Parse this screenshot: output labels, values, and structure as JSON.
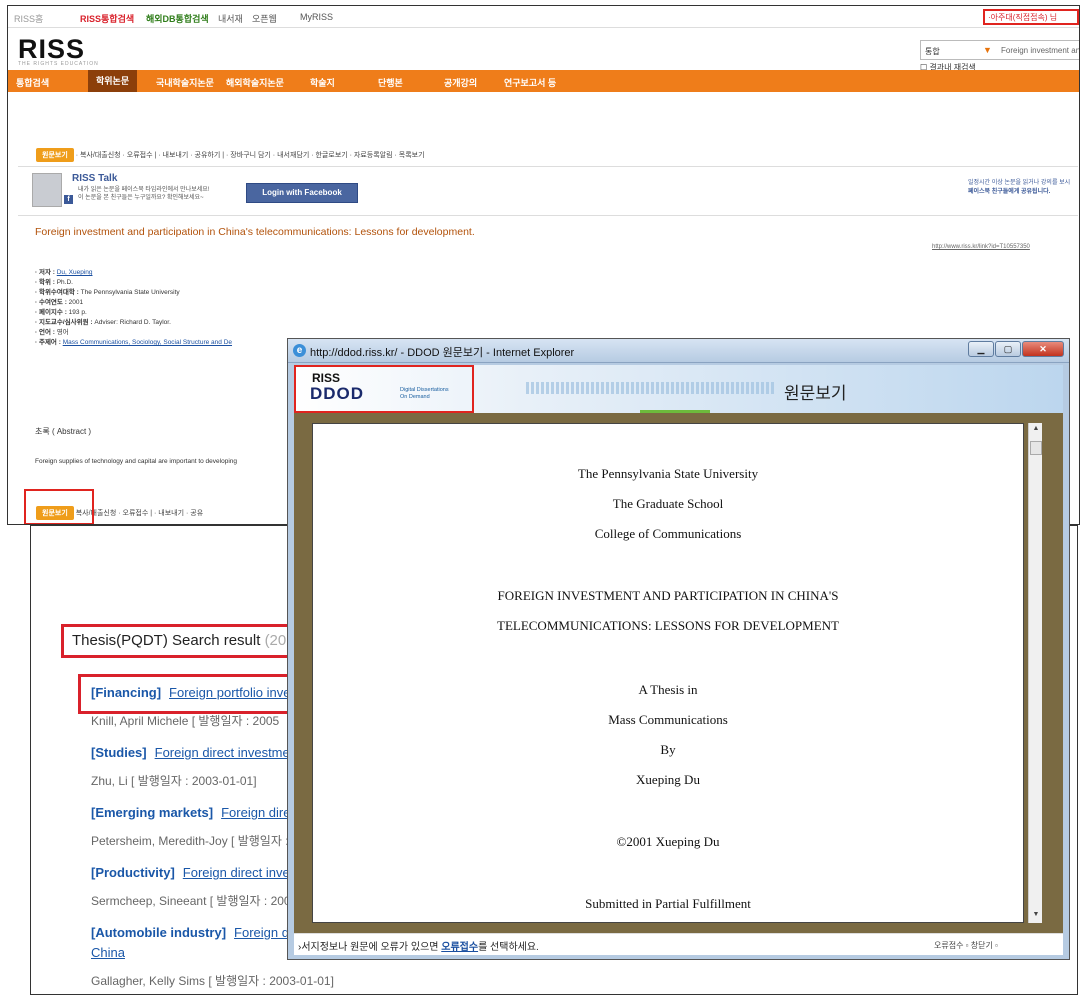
{
  "riss": {
    "topbar": {
      "home": "RISS홈",
      "integrated": "RISS통합검색",
      "overseas": "해외DB통합검색",
      "library": "내서재",
      "open": "오픈웹",
      "myriss": "MyRISS",
      "user": "·아주대(직접접속) 님"
    },
    "logo": "RISS",
    "logo_sub": "THE RIGHTS EDUCATION",
    "search": {
      "scope": "통합",
      "query": "Foreign investment and",
      "within_results": "결과내 재검색"
    },
    "nav": [
      "통합검색",
      "학위논문",
      "국내학술지논문",
      "해외학술지논문",
      "학술지",
      "단행본",
      "공개강의",
      "연구보고서 등"
    ],
    "toolbar": {
      "button": "원문보기",
      "items": "· 복사/대출신청  · 오류접수 | · 내보내기  · 공유하기 | · 장바구니 담기 · 내서재담기 · 한글로보기 · 자료등록알림 · 목록보기"
    },
    "talk": {
      "title": "RISS Talk",
      "line1": "내가 읽은 논문을 페이스북 타임라인에서 만나보세요!",
      "line2": "이 논문을 본 친구들은 누구일까요? 확인해보세요~",
      "fb_button": "Login with Facebook",
      "right1": "일정시간 이상 논문을 읽거나 강의를 보시",
      "right2": "페이스북 친구들에게 공유됩니다."
    },
    "doc_title": "Foreign investment and participation in China's telecommunications: Lessons for development.",
    "doc_url": "http://www.riss.kr/link?id=T10557350",
    "meta": {
      "author_label": "· 저자 : ",
      "author": "Du, Xueping",
      "degree_label": "· 학위 : ",
      "degree": "Ph.D.",
      "school_label": "· 학위수여대학 : ",
      "school": "The Pennsylvania State University",
      "year_label": "· 수여연도 : ",
      "year": "2001",
      "pages_label": "· 페이지수 : ",
      "pages": "193 p.",
      "advisor_label": "· 지도교수/심사위원 : ",
      "advisor": "Adviser: Richard D. Taylor.",
      "lang_label": "· 언어 : ",
      "lang": "영어",
      "subject_label": "· 주제어 : ",
      "subject": "Mass Communications, Sociology, Social Structure and De"
    },
    "abstract_heading": "초록 ( Abstract )",
    "abstract_text": "Foreign supplies of technology and capital are important to developing",
    "bottom_toolbar": {
      "button": "원문보기",
      "items": "복사/대출신청 · 오류접수 | · 내보내기  · 공유"
    }
  },
  "popup": {
    "window_title": "http://ddod.riss.kr/ - DDOD 원문보기 - Internet Explorer",
    "logo1": "RISS",
    "logo2": "DDOD",
    "logo_sub1": "Digital Dissertations",
    "logo_sub2": "On Demand",
    "header_title": "원문보기",
    "paper": {
      "university": "The Pennsylvania State University",
      "school": "The Graduate School",
      "college": "College of Communications",
      "title1": "FOREIGN INVESTMENT AND PARTICIPATION IN CHINA'S",
      "title2": "TELECOMMUNICATIONS: LESSONS FOR DEVELOPMENT",
      "thesis_in": "A Thesis in",
      "field": "Mass Communications",
      "by": "By",
      "author": "Xueping Du",
      "copyright": "©2001 Xueping Du",
      "submitted": "Submitted in Partial Fulfillment"
    },
    "status": {
      "prefix": "›서지정보나 원문에 오류가 있으면 ",
      "link": "오류접수",
      "suffix": "를 선택하세요.",
      "right": "오류접수 ▫  창닫기 ▫"
    }
  },
  "pqdt": {
    "title": "Thesis(PQDT) Search result",
    "count": "(2012390",
    "results": [
      {
        "tag": "[Financing]",
        "link": "Foreign portfolio inves",
        "author": "Knill, April Michele [ 발행일자 : 2005"
      },
      {
        "tag": "[Studies]",
        "link": "Foreign direct investmen",
        "author": "Zhu, Li [ 발행일자 : 2003-01-01]"
      },
      {
        "tag": "[Emerging markets]",
        "link": "Foreign direct",
        "author": "Petersheim, Meredith-Joy [ 발행일자 :"
      },
      {
        "tag": "[Productivity]",
        "link": "Foreign direct invest",
        "author": "Sermcheep, Sineeant [ 발행일자 : 200"
      },
      {
        "tag": "[Automobile industry]",
        "link": "Foreign dir",
        "link2": "China",
        "author": "Gallagher, Kelly Sims [ 발행일자 : 2003-01-01]"
      }
    ]
  }
}
